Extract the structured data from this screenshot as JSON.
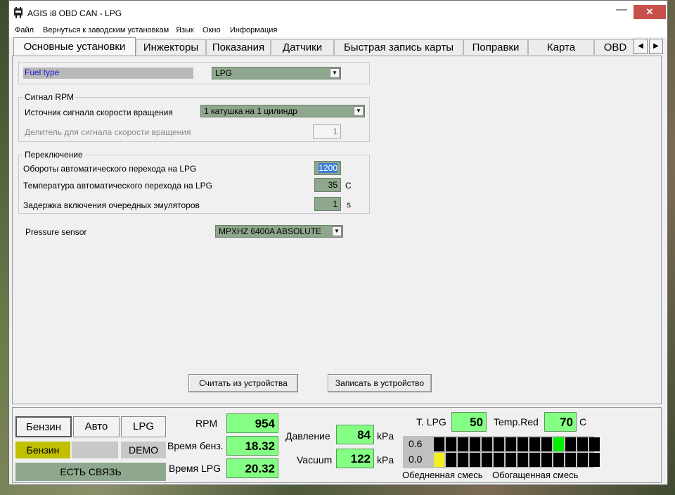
{
  "window": {
    "title": "AGIS i8 OBD CAN - LPG",
    "minimize": "—",
    "close": "✕"
  },
  "menu": [
    "Файл",
    "Вернуться к заводским установкам",
    "Язык",
    "Окно",
    "Информация"
  ],
  "tabs": [
    "Основные установки",
    "Инжекторы",
    "Показания",
    "Датчики",
    "Быстрая запись карты",
    "Поправки",
    "Карта",
    "OBD"
  ],
  "tab_scroll": {
    "left": "◀",
    "right": "▶"
  },
  "fuel": {
    "label": "Fuel type",
    "value": "LPG"
  },
  "rpm_signal": {
    "title": "Сигнал RPM",
    "source_label": "Источник сигнала скорости вращения",
    "source_value": "1 катушка на 1 цилиндр",
    "divider_label": "Делитель для сигнала скорости вращения",
    "divider_value": "1"
  },
  "switching": {
    "title": "Переключение",
    "rpm_label": "Обороты автоматического перехода на LPG",
    "rpm_value": "1200",
    "temp_label": "Температура автоматического перехода на LPG",
    "temp_value": "35",
    "temp_unit": "C",
    "delay_label": "Задержка включения очередных эмуляторов",
    "delay_value": "1",
    "delay_unit": "s"
  },
  "pressure": {
    "label": "Pressure sensor",
    "value": "MPXHZ 6400A ABSOLUTE"
  },
  "buttons": {
    "read": "Считать из устройства",
    "write": "Записать в устройство"
  },
  "mode": {
    "petrol": "Бензин",
    "auto": "Авто",
    "lpg": "LPG",
    "status_fuel": "Бензин",
    "status_demo": "DEMO",
    "connection": "ЕСТЬ СВЯЗЬ"
  },
  "gauges": {
    "rpm_label": "RPM",
    "rpm_value": "954",
    "petrol_time_label": "Время бенз.",
    "petrol_time_value": "18.32",
    "lpg_time_label": "Время LPG",
    "lpg_time_value": "20.32",
    "pressure_label": "Давление",
    "pressure_value": "84",
    "pressure_unit": "kPa",
    "vacuum_label": "Vacuum",
    "vacuum_value": "122",
    "vacuum_unit": "kPa",
    "tlpg_label": "T. LPG",
    "tlpg_value": "50",
    "tred_label": "Temp.Red",
    "tred_value": "70",
    "tred_unit": "C"
  },
  "mixture": {
    "row1_label": "0.6",
    "row2_label": "0.0",
    "lean_label": "Обедненная смесь",
    "rich_label": "Обогащенная смесь",
    "columns": 14,
    "row1_active_index": 10,
    "row2_active_index": 0,
    "colors": {
      "active1": "#00ee00",
      "active2": "#f0f020",
      "off": "#000000"
    }
  },
  "colors": {
    "field": "#8fa78c",
    "gauge": "#84ff84",
    "status_petrol": "#c0c000",
    "connection": "#8fa78c",
    "close": "#c7504a"
  }
}
